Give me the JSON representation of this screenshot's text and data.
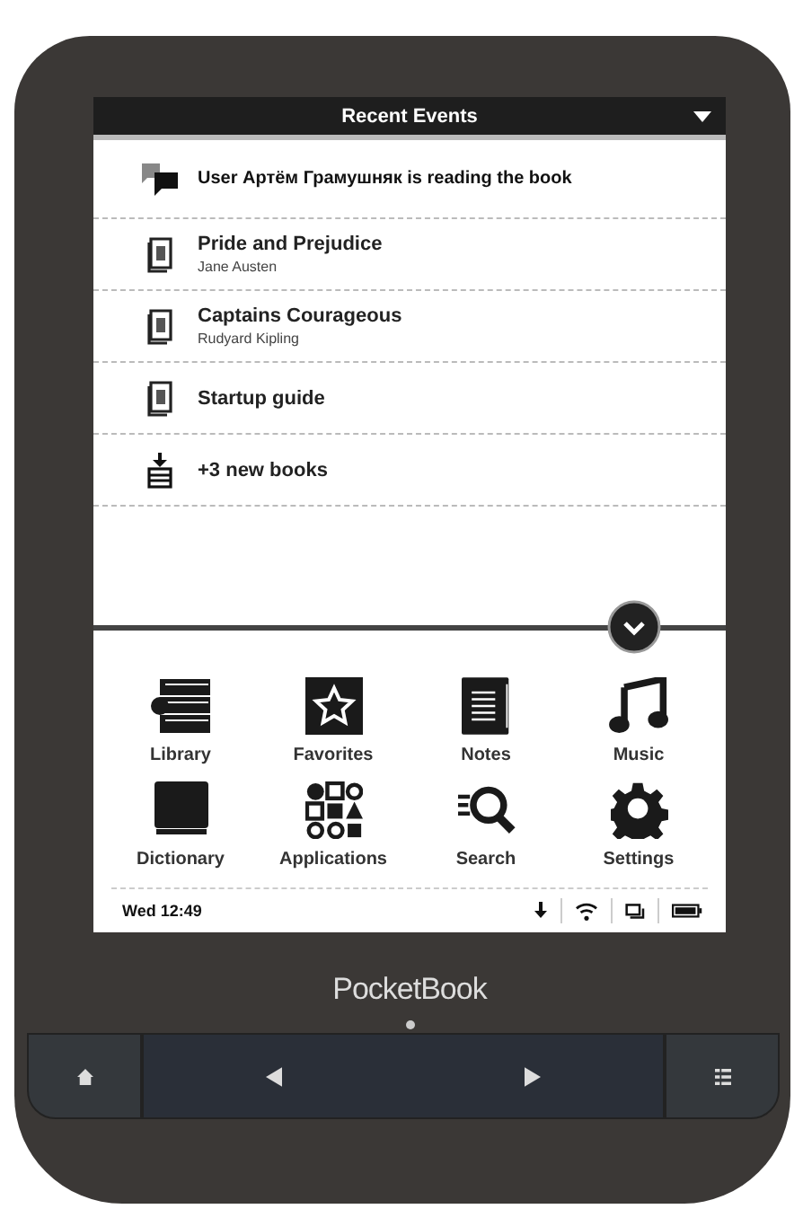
{
  "header": {
    "title": "Recent Events"
  },
  "events": [
    {
      "kind": "user",
      "title": "User Артём Грамушняк is reading the book"
    },
    {
      "kind": "book",
      "title": "Pride and Prejudice",
      "subtitle": "Jane Austen"
    },
    {
      "kind": "book",
      "title": "Captains Courageous",
      "subtitle": "Rudyard Kipling"
    },
    {
      "kind": "book",
      "title": "Startup guide"
    },
    {
      "kind": "download",
      "title": "+3 new books"
    }
  ],
  "apps": [
    {
      "kind": "library",
      "label": "Library"
    },
    {
      "kind": "favorites",
      "label": "Favorites"
    },
    {
      "kind": "notes",
      "label": "Notes"
    },
    {
      "kind": "music",
      "label": "Music"
    },
    {
      "kind": "dictionary",
      "label": "Dictionary"
    },
    {
      "kind": "applications",
      "label": "Applications"
    },
    {
      "kind": "search",
      "label": "Search"
    },
    {
      "kind": "settings",
      "label": "Settings"
    }
  ],
  "status_bar": {
    "time": "Wed 12:49"
  },
  "brand": "PocketBook"
}
